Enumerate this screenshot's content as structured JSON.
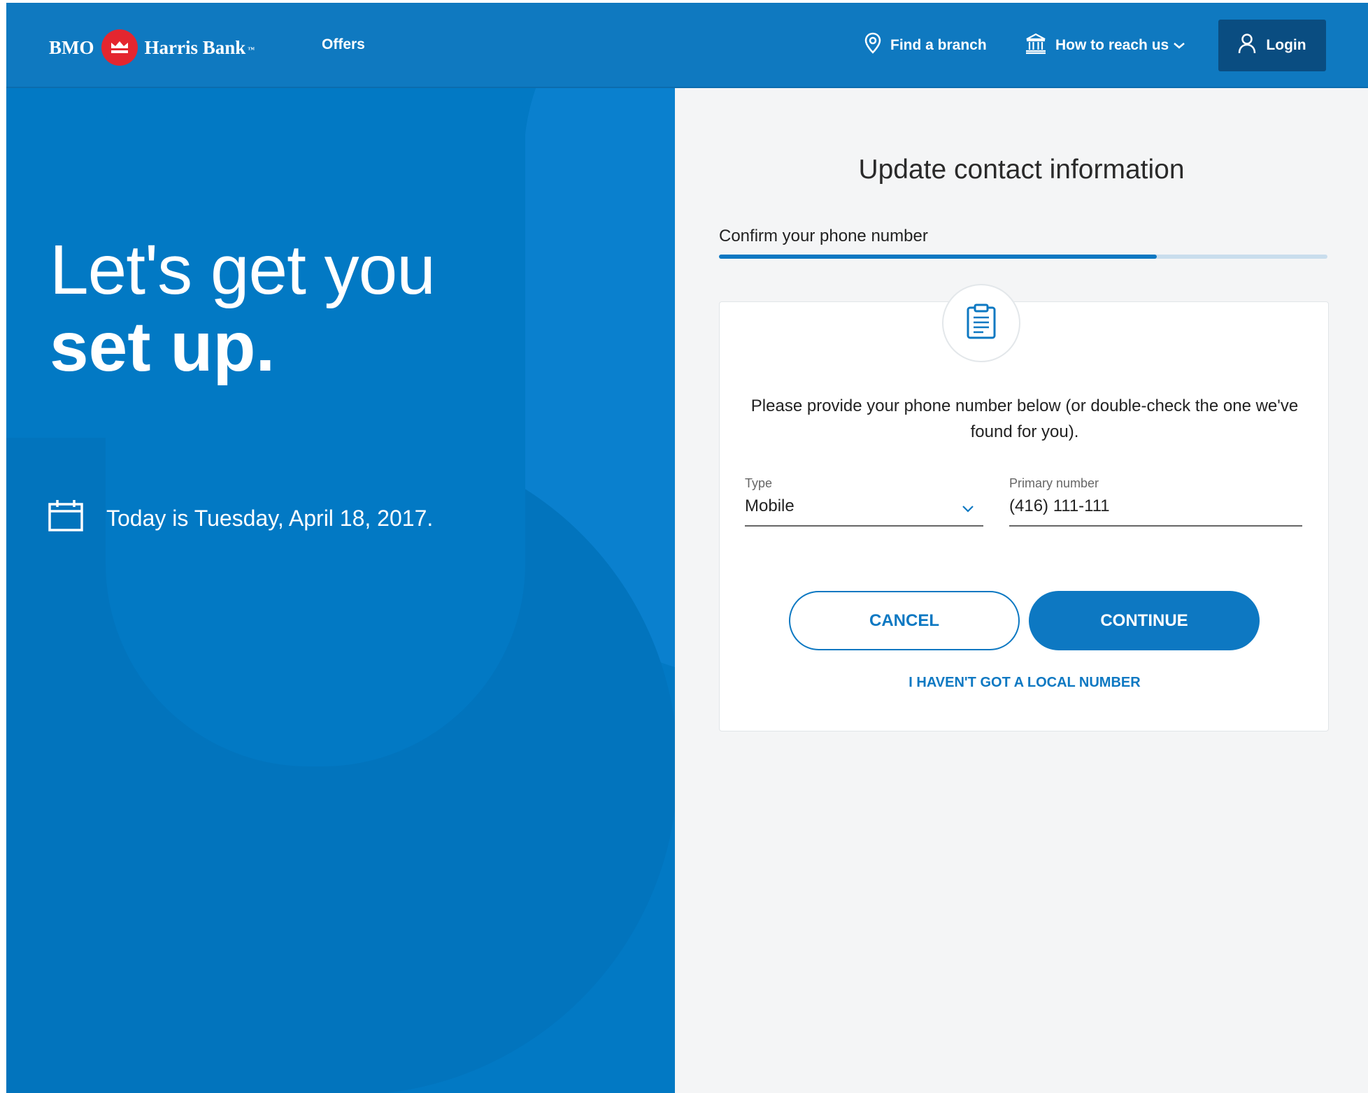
{
  "header": {
    "brand_left": "BMO",
    "brand_right": "Harris Bank",
    "brand_tm": "™",
    "offers": "Offers",
    "find_branch": "Find a branch",
    "how_to_reach": "How to reach us",
    "login": "Login"
  },
  "hero": {
    "title_light": "Let's get you",
    "title_bold": "set up.",
    "today": "Today is Tuesday, April 18, 2017."
  },
  "panel": {
    "title": "Update contact information",
    "step_label": "Confirm your phone number",
    "progress_fraction": 0.72
  },
  "card": {
    "description": "Please provide your phone number below (or double-check the one we've found for you).",
    "type_label": "Type",
    "type_value": "Mobile",
    "primary_label": "Primary number",
    "primary_value": "(416) 111-111",
    "cancel": "CANCEL",
    "continue": "CONTINUE",
    "no_local": "I HAVEN'T GOT A LOCAL NUMBER"
  },
  "colors": {
    "header_blue": "#0f79c0",
    "hero_blue": "#0279c4",
    "accent_blue": "#0d78c2",
    "login_navy": "#0a4d81",
    "bmo_red": "#e4262f"
  },
  "icons": [
    "bmo-roundel-icon",
    "location-pin-icon",
    "bank-building-icon",
    "chevron-down-icon",
    "user-icon",
    "calendar-icon",
    "clipboard-icon"
  ]
}
